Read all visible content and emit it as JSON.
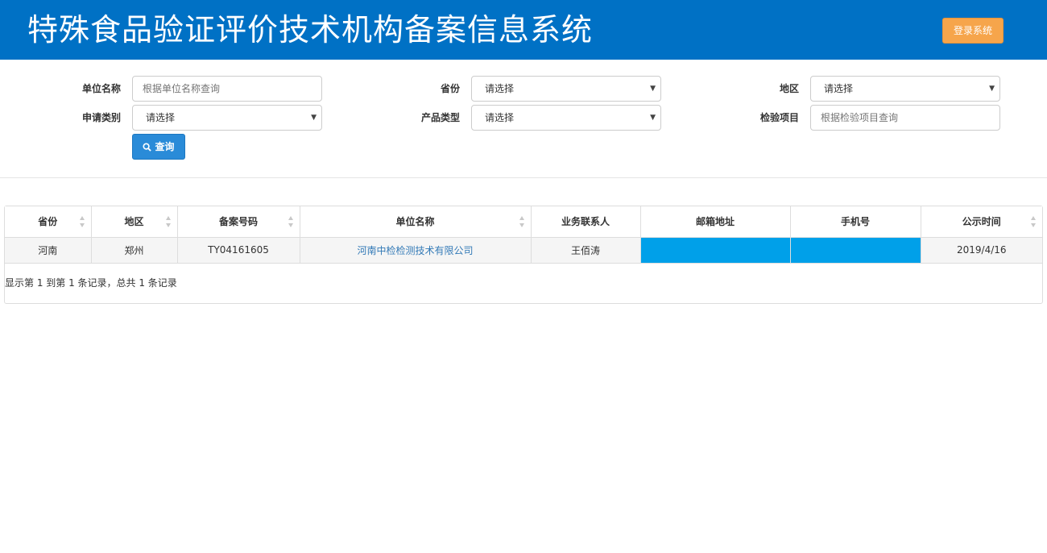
{
  "header": {
    "title": "特殊食品验证评价技术机构备案信息系统",
    "login_label": "登录系统"
  },
  "filters": {
    "unit_name_label": "单位名称",
    "unit_name_placeholder": "根据单位名称查询",
    "province_label": "省份",
    "province_value": "请选择",
    "region_label": "地区",
    "region_value": "请选择",
    "apply_type_label": "申请类别",
    "apply_type_value": "请选择",
    "product_type_label": "产品类型",
    "product_type_value": "请选择",
    "inspection_label": "检验项目",
    "inspection_placeholder": "根据检验项目查询",
    "search_label": "查询"
  },
  "table": {
    "columns": [
      "省份",
      "地区",
      "备案号码",
      "单位名称",
      "业务联系人",
      "邮箱地址",
      "手机号",
      "公示时间"
    ],
    "rows": [
      {
        "province": "河南",
        "region": "郑州",
        "record_no": "TY04161605",
        "unit_name": "河南中检检测技术有限公司",
        "contact": "王佰涛",
        "email": "",
        "phone": "",
        "publish_date": "2019/4/16"
      }
    ],
    "summary": "显示第 1 到第 1 条记录，总共 1 条记录"
  },
  "colors": {
    "header_bg": "#0071c5",
    "login_button": "#f6a54b",
    "search_button": "#2a8bd8",
    "masked_cell": "#00a0e9",
    "link": "#337ab7"
  },
  "icons": {
    "search": "search-icon",
    "sort": "sort-icon",
    "dropdown": "caret-down-icon"
  }
}
